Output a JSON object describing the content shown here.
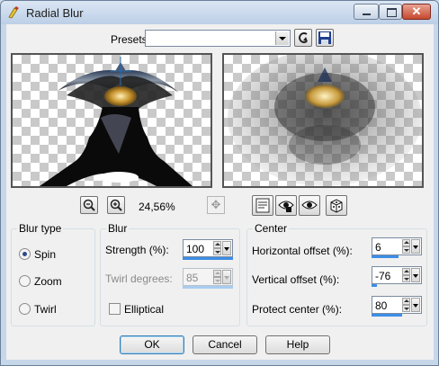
{
  "window": {
    "title": "Radial Blur"
  },
  "presets": {
    "label": "Presets:",
    "value": ""
  },
  "zoom": {
    "value": "24,56%"
  },
  "blur_type": {
    "title": "Blur type",
    "options": [
      {
        "label": "Spin",
        "selected": true
      },
      {
        "label": "Zoom",
        "selected": false
      },
      {
        "label": "Twirl",
        "selected": false
      }
    ]
  },
  "blur": {
    "title": "Blur",
    "strength_label": "Strength (%):",
    "strength_value": "100",
    "strength_fill": 1.0,
    "twirl_label": "Twirl degrees:",
    "twirl_value": "85",
    "twirl_fill": 1.0,
    "elliptical_label": "Elliptical",
    "elliptical_checked": false
  },
  "center": {
    "title": "Center",
    "h_offset_label": "Horizontal offset (%):",
    "h_offset_value": "6",
    "v_offset_label": "Vertical offset (%):",
    "v_offset_value": "-76",
    "protect_label": "Protect center (%):",
    "protect_value": "80"
  },
  "buttons": {
    "ok": "OK",
    "cancel": "Cancel",
    "help": "Help"
  },
  "colors": {
    "slider": "#3d8ee6",
    "slider_disabled": "#a8cdf0",
    "close_button": "#c7472e",
    "title_bar": "#bccfe6"
  }
}
